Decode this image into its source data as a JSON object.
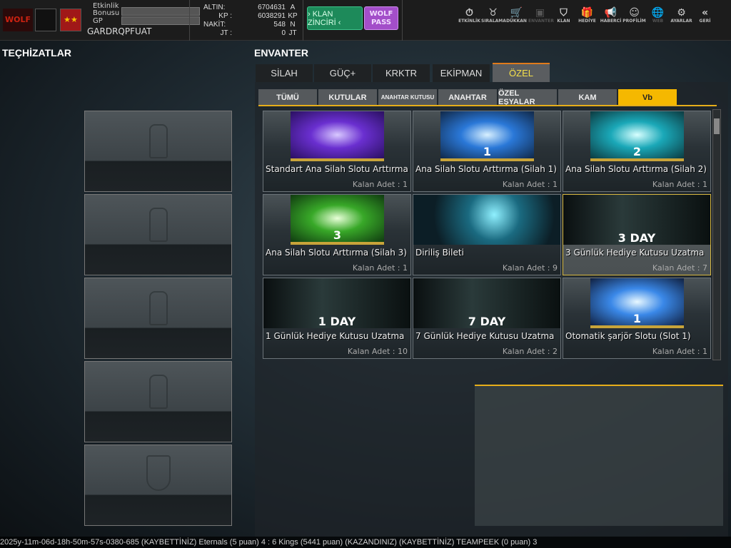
{
  "header": {
    "etkinlik_label": "Etkinlik Bonusu",
    "gp_label": "GP",
    "username": "GARDRQPFUAT",
    "currencies": [
      {
        "label": "ALTIN:",
        "value": "6704631",
        "unit": "A"
      },
      {
        "label": "KP :",
        "value": "6038291",
        "unit": "KP"
      },
      {
        "label": "NAKİT:",
        "value": "548",
        "unit": "N"
      },
      {
        "label": "JT :",
        "value": "0",
        "unit": "JT"
      }
    ],
    "klan_button": "› KLAN ZİNCİRİ ‹",
    "wolf_button": "WOLF PASS",
    "nav": [
      {
        "label": "ETKİNLİK",
        "icon": "⏱"
      },
      {
        "label": "SIRALAMA",
        "icon": "♉"
      },
      {
        "label": "DÜKKAN",
        "icon": "🛒"
      },
      {
        "label": "ENVANTER",
        "icon": "▣"
      },
      {
        "label": "KLAN",
        "icon": "⛉"
      },
      {
        "label": "HEDİYE",
        "icon": "🎁"
      },
      {
        "label": "HABERCİ",
        "icon": "📢"
      },
      {
        "label": "PROFİLİM",
        "icon": "☺"
      },
      {
        "label": "WEB",
        "icon": "🌐"
      },
      {
        "label": "AYARLAR",
        "icon": "⚙"
      },
      {
        "label": "GERİ",
        "icon": "«"
      }
    ]
  },
  "left": {
    "title": "TEÇHİZATLAR"
  },
  "inventory": {
    "title": "ENVANTER",
    "tabs": [
      "SİLAH",
      "GÜÇ+",
      "KRKTR",
      "EKİPMAN",
      "ÖZEL"
    ],
    "active_tab": 4,
    "subtabs": [
      "TÜMÜ",
      "KUTULAR",
      "ANAHTAR KUTUSU",
      "ANAHTAR",
      "ÖZEL EŞYALAR",
      "KAM",
      "Vb"
    ],
    "active_subtab": 6,
    "items": [
      {
        "name": "Standart Ana Silah Slotu Arttırma",
        "count": "Kalan Adet : 1",
        "badge": ""
      },
      {
        "name": "Ana Silah Slotu Arttırma (Silah 1)",
        "count": "Kalan Adet : 1",
        "badge": "1"
      },
      {
        "name": "Ana Silah Slotu Arttırma (Silah 2)",
        "count": "Kalan Adet : 1",
        "badge": "2"
      },
      {
        "name": "Ana Silah Slotu Arttırma (Silah 3)",
        "count": "Kalan Adet : 1",
        "badge": "3"
      },
      {
        "name": "Diriliş Bileti",
        "count": "Kalan Adet : 9",
        "badge": ""
      },
      {
        "name": "3 Günlük Hediye Kutusu Uzatma",
        "count": "Kalan Adet : 7",
        "badge": "3 DAY"
      },
      {
        "name": "1 Günlük Hediye Kutusu Uzatma",
        "count": "Kalan Adet : 10",
        "badge": "1 DAY"
      },
      {
        "name": "7 Günlük Hediye Kutusu Uzatma",
        "count": "Kalan Adet : 2",
        "badge": "7 DAY"
      },
      {
        "name": "Otomatik şarjör Slotu (Slot 1)",
        "count": "Kalan Adet : 1",
        "badge": "1"
      }
    ]
  },
  "ticker": {
    "text": "2025y-11m-06d-18h-50m-57s-0380-685   (KAYBETTİNİZ) Eternals (5 puan) 4 : 6 Kings (5441 puan) (KAZANDINIZ)          (KAYBETTİNİZ) TEAMPEEK (0 puan) 3"
  },
  "colors": {
    "accent": "#f5b800",
    "active_tab_text": "#f5e04a",
    "klan": "#1d8a5a",
    "wolf": "#a34ec9"
  }
}
